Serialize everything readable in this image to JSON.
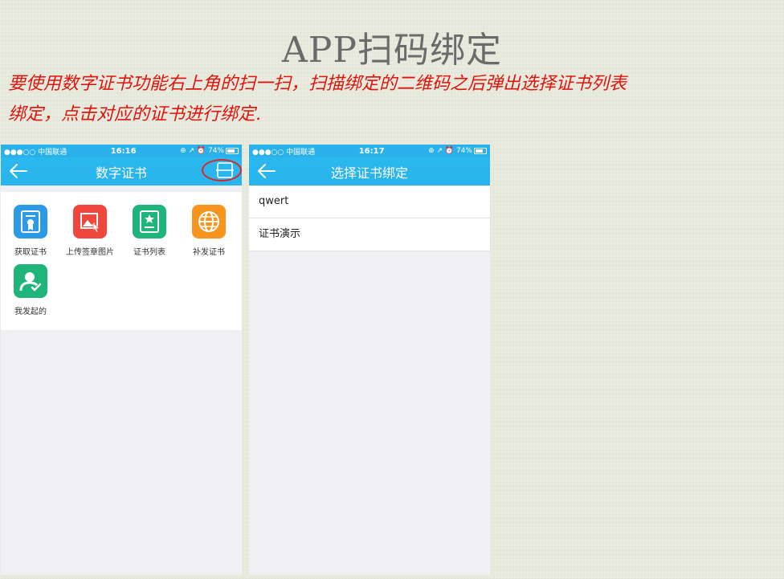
{
  "slide": {
    "title": "APP扫码绑定",
    "note_line1": "要使用数字证书功能右上角的扫一扫，扫描绑定的二维码之后弹出选择证书列表",
    "note_line2": "绑定，点击对应的证书进行绑定."
  },
  "screen1": {
    "status": {
      "carrier": "●●●○○ 中国联通",
      "time": "16:16",
      "right": "⊕ ↗ ⏰ 74%"
    },
    "nav_title": "数字证书",
    "tiles": [
      {
        "label": "获取证书",
        "color": "#2c9ae6",
        "icon": "certificate-icon"
      },
      {
        "label": "上传签章图片",
        "color": "#f0473c",
        "icon": "upload-image-icon"
      },
      {
        "label": "证书列表",
        "color": "#1fb57a",
        "icon": "cert-list-icon"
      },
      {
        "label": "补发证书",
        "color": "#f7941e",
        "icon": "globe-icon"
      },
      {
        "label": "我发起的",
        "color": "#1fb57a",
        "icon": "user-check-icon"
      }
    ]
  },
  "screen2": {
    "status": {
      "carrier": "●●●○○ 中国联通",
      "time": "16:17",
      "right": "⊕ ↗ ⏰ 74%"
    },
    "nav_title": "选择证书绑定",
    "items": [
      "qwert",
      "证书演示"
    ]
  },
  "colors": {
    "nav": "#29b4ec",
    "highlight": "#d62a2a",
    "note": "#e0140c"
  }
}
